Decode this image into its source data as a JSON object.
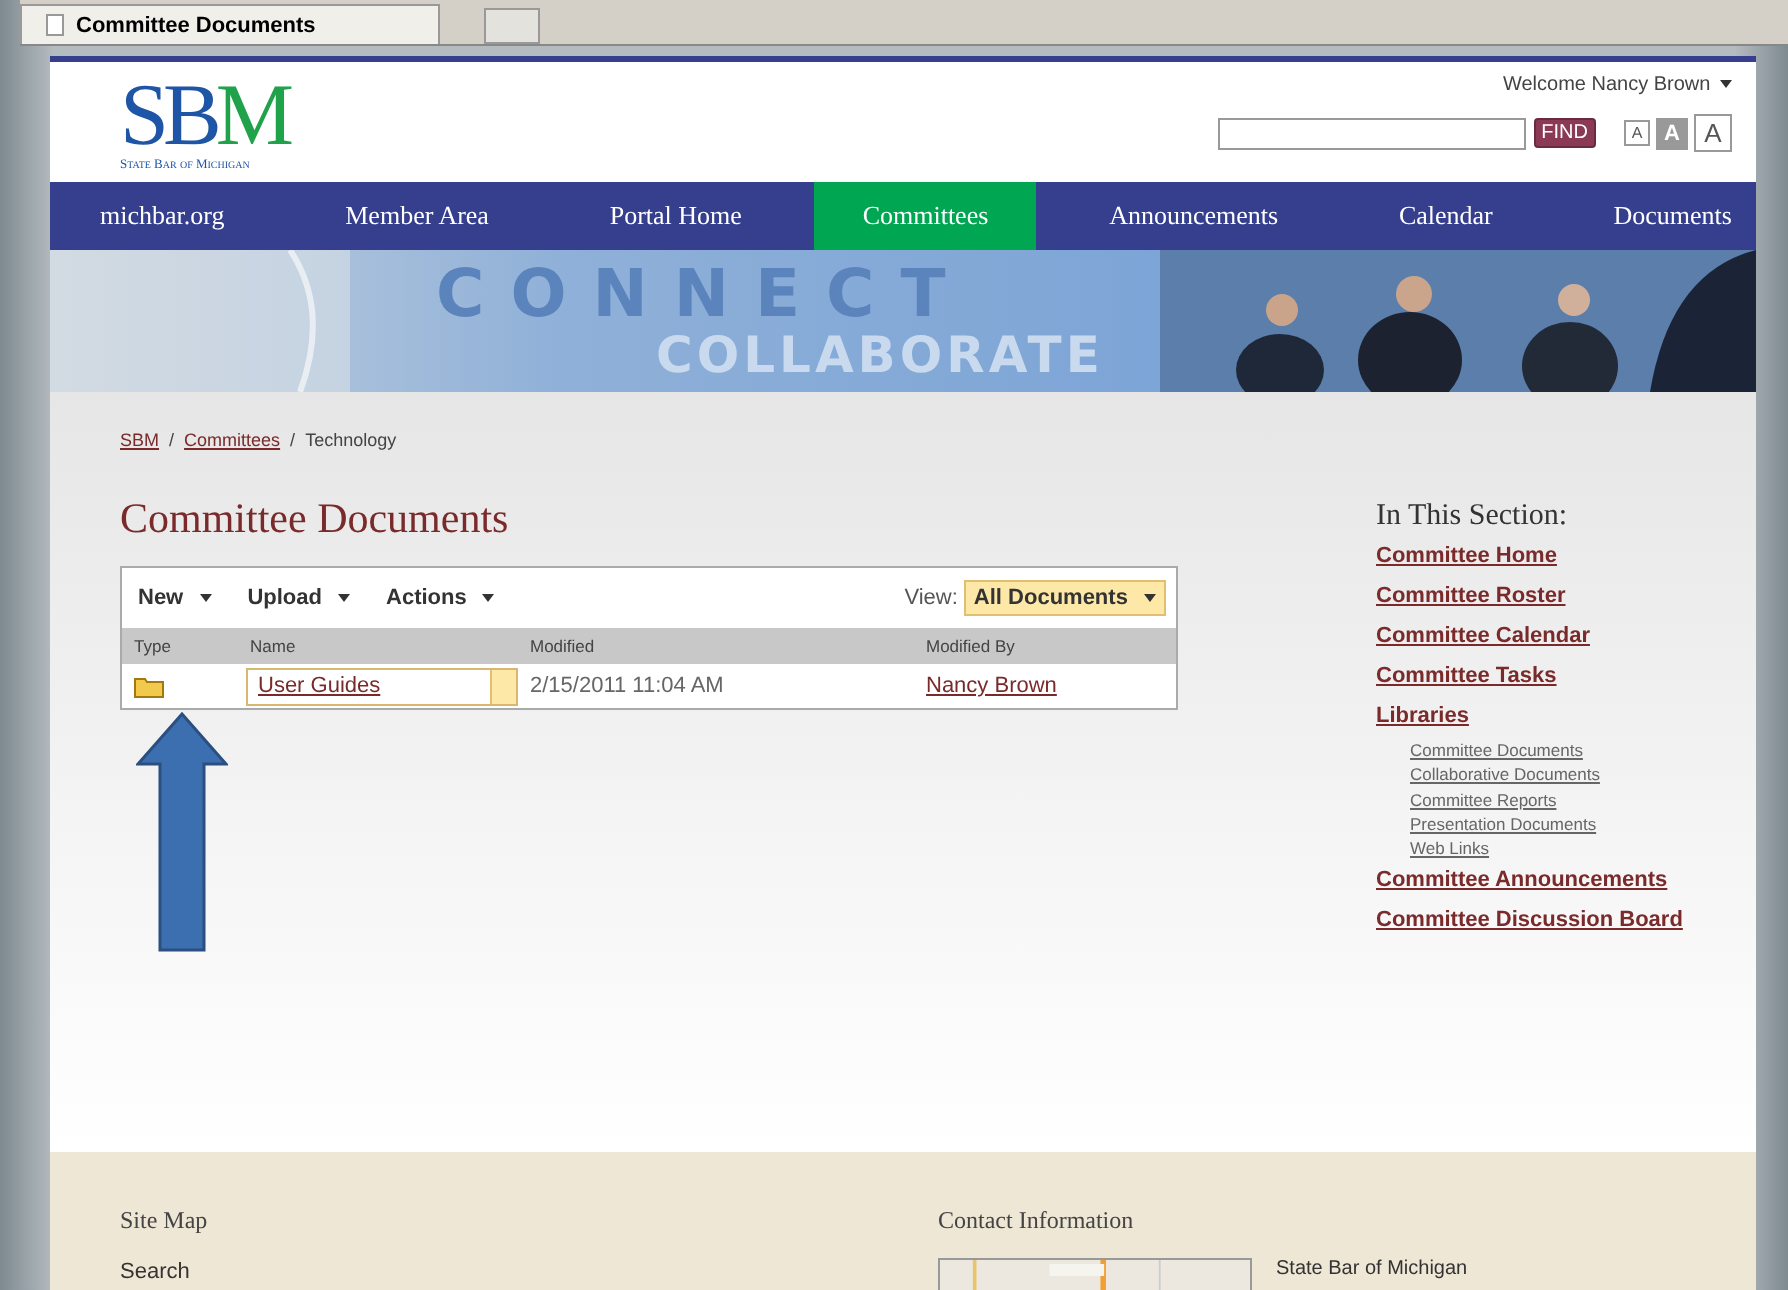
{
  "browser_tab": {
    "title": "Committee Documents"
  },
  "header": {
    "logo": "SBM",
    "logo_subtitle": "State Bar of Michigan",
    "welcome": "Welcome Nancy Brown",
    "find_button": "FIND",
    "text_sizes": [
      {
        "label": "A",
        "selected": false
      },
      {
        "label": "A",
        "selected": true
      },
      {
        "label": "A",
        "selected": false
      }
    ]
  },
  "nav": [
    {
      "label": "michbar.org",
      "selected": false
    },
    {
      "label": "Member Area",
      "selected": false
    },
    {
      "label": "Portal Home",
      "selected": false
    },
    {
      "label": "Committees",
      "selected": true
    },
    {
      "label": "Announcements",
      "selected": false
    },
    {
      "label": "Calendar",
      "selected": false
    },
    {
      "label": "Documents",
      "selected": false
    }
  ],
  "banner": {
    "line_1": "CONNECT",
    "line_2": "COLLABORATE"
  },
  "breadcrumb": [
    {
      "label": "SBM",
      "link": true
    },
    {
      "separator": "/"
    },
    {
      "label": "Committees",
      "link": true
    },
    {
      "separator": "/"
    },
    {
      "label": "Technology",
      "link": false
    }
  ],
  "page_title": "Committee Documents",
  "toolbar": {
    "menus": [
      "New",
      "Upload",
      "Actions"
    ],
    "view_label": "View:",
    "view_value": "All Documents"
  },
  "table": {
    "columns": [
      "Type",
      "Name",
      "Modified",
      "Modified By"
    ],
    "rows": [
      {
        "kind": "folder",
        "name": "User Guides",
        "modified": "2/15/2011 11:04 AM",
        "modified_by": "Nancy Brown"
      }
    ]
  },
  "section": {
    "title": "In This Section:",
    "links": [
      {
        "label": "Committee Home"
      },
      {
        "label": "Committee Roster"
      },
      {
        "label": "Committee Calendar"
      },
      {
        "label": "Committee Tasks"
      },
      {
        "label": "Libraries",
        "children": [
          {
            "label": "Committee Documents"
          },
          {
            "label": "Collaborative Documents"
          },
          {
            "label": "Committee Reports"
          },
          {
            "label": "Presentation Documents"
          },
          {
            "label": "Web Links"
          }
        ]
      },
      {
        "label": "Committee Announcements"
      },
      {
        "label": "Committee Discussion Board"
      }
    ]
  },
  "footer": {
    "site_map": "Site Map",
    "search_link": "Search",
    "contact": "Contact Information",
    "address": "State Bar of Michigan"
  }
}
